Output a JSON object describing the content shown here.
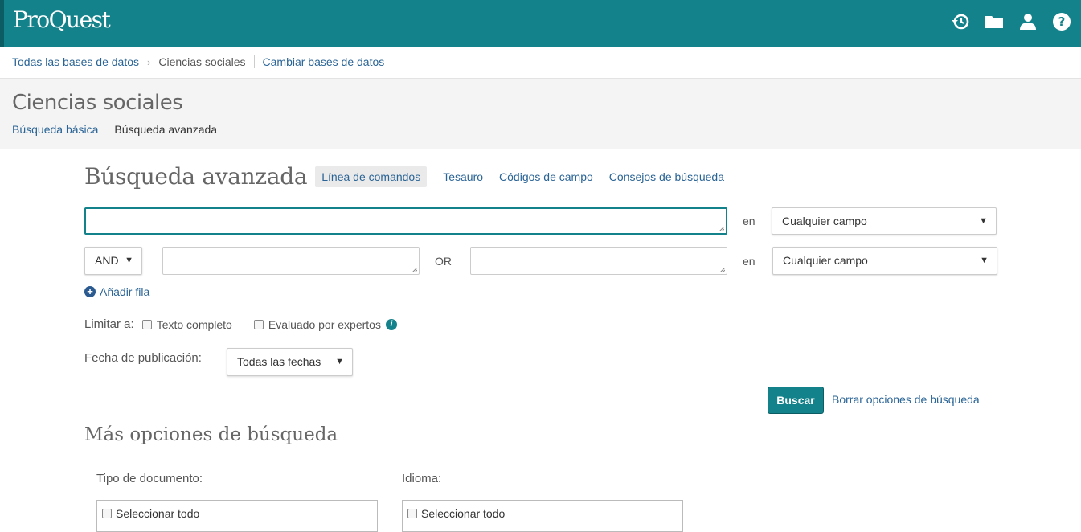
{
  "header": {
    "logo": "ProQuest",
    "icons": [
      "history-icon",
      "folder-icon",
      "user-icon",
      "help-icon"
    ]
  },
  "breadcrumb": {
    "all_db": "Todas las bases de datos",
    "current": "Ciencias sociales",
    "change": "Cambiar bases de datos"
  },
  "page": {
    "title": "Ciencias sociales",
    "tabs": [
      "Búsqueda básica",
      "Búsqueda avanzada"
    ]
  },
  "advanced": {
    "heading": "Búsqueda avanzada",
    "links": [
      "Línea de comandos",
      "Tesauro",
      "Códigos de campo",
      "Consejos de búsqueda"
    ],
    "row1": {
      "value": "",
      "in_label": "en",
      "field": "Cualquier campo"
    },
    "row2": {
      "operator": "AND",
      "value_a": "",
      "or_label": "OR",
      "value_b": "",
      "in_label": "en",
      "field": "Cualquier campo"
    },
    "add_row": "Añadir fila",
    "limit_label": "Limitar a:",
    "limit_full_text": "Texto completo",
    "limit_peer": "Evaluado por expertos",
    "date_label": "Fecha de publicación:",
    "date_value": "Todas las fechas",
    "search_button": "Buscar",
    "clear_link": "Borrar opciones de búsqueda"
  },
  "more": {
    "title": "Más opciones de búsqueda",
    "doc_type_label": "Tipo de documento:",
    "doc_type_select_all": "Seleccionar todo",
    "language_label": "Idioma:",
    "language_select_all": "Seleccionar todo"
  },
  "colors": {
    "brand": "#13828a",
    "link": "#2a6496"
  }
}
